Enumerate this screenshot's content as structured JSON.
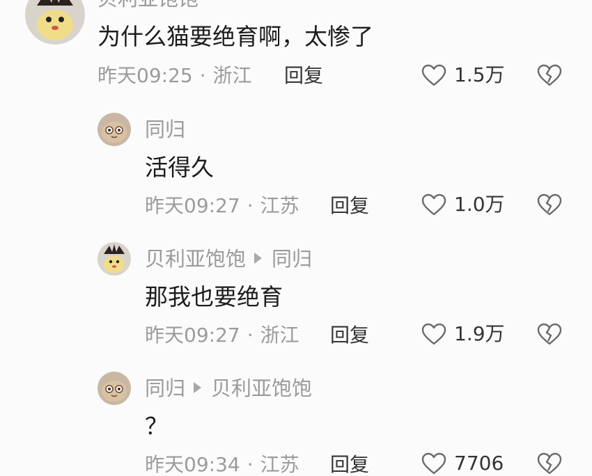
{
  "comments": [
    {
      "author": "贝利亚饱饱",
      "reply_to": "",
      "text": "为什么猫要绝育啊，太惨了",
      "time": "昨天09:25",
      "region": "浙江",
      "reply_label": "回复",
      "likes": "1.5万",
      "avatar_icon": "cartoon-bird-avatar"
    },
    {
      "author": "同归",
      "reply_to": "",
      "text": "活得久",
      "time": "昨天09:27",
      "region": "江苏",
      "reply_label": "回复",
      "likes": "1.0万",
      "avatar_icon": "cat-face-avatar"
    },
    {
      "author": "贝利亚饱饱",
      "reply_to": "同归",
      "text": "那我也要绝育",
      "time": "昨天09:27",
      "region": "浙江",
      "reply_label": "回复",
      "likes": "1.9万",
      "avatar_icon": "cartoon-bird-avatar"
    },
    {
      "author": "同归",
      "reply_to": "贝利亚饱饱",
      "text": "？",
      "time": "昨天09:34",
      "region": "江苏",
      "reply_label": "回复",
      "likes": "7706",
      "avatar_icon": "cat-face-avatar"
    }
  ],
  "dot_separator": "·",
  "colors": {
    "meta": "#9b9b9b",
    "text": "#1c1c1c",
    "background": "#fbfbfb"
  }
}
